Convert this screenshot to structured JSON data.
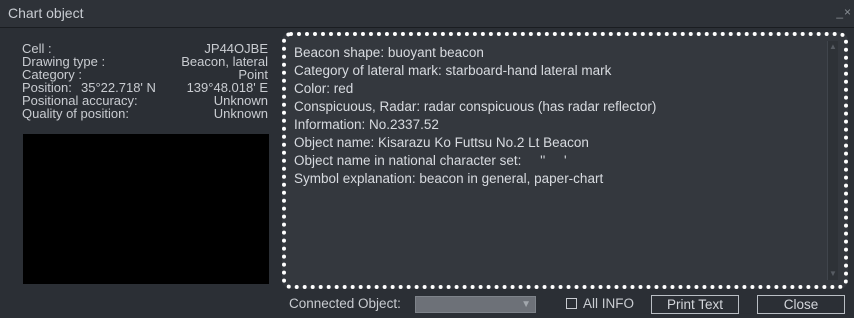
{
  "window": {
    "title": "Chart object",
    "controls": "_×"
  },
  "info": {
    "cell": {
      "label": "Cell :",
      "value": "JP44OJBE"
    },
    "drawing_type": {
      "label": "Drawing type :",
      "value": "Beacon, lateral"
    },
    "category": {
      "label": "Category :",
      "value": "Point"
    },
    "position": {
      "label": "Position:",
      "lat": "35°22.718' N",
      "lon": "139°48.018' E"
    },
    "positional_accuracy": {
      "label": "Positional accuracy:",
      "value": "Unknown"
    },
    "quality_of_position": {
      "label": "Quality of position:",
      "value": "Unknown"
    }
  },
  "details": {
    "lines": [
      "Beacon shape: buoyant beacon",
      "Category of lateral mark: starboard-hand lateral mark",
      "Color: red",
      "Conspicuous, Radar: radar conspicuous (has radar reflector)",
      "Information: No.2337.52",
      "Object name: Kisarazu Ko Futtsu No.2 Lt Beacon",
      "Object name in national character set:     ''     '",
      "Symbol explanation: beacon in general, paper-chart"
    ]
  },
  "bottom": {
    "connected_label": "Connected Object:",
    "connected_value": "",
    "all_info_label": "All INFO",
    "all_info_checked": false,
    "print_label": "Print Text",
    "close_label": "Close"
  },
  "icons": {
    "scroll_up": "▲",
    "scroll_down": "▼",
    "select_caret": "▼"
  },
  "colors": {
    "window_bg": "#2b2f35",
    "text": "#c9ccd1",
    "highlight_border": "#ffffff",
    "preview_bg": "#000000"
  }
}
